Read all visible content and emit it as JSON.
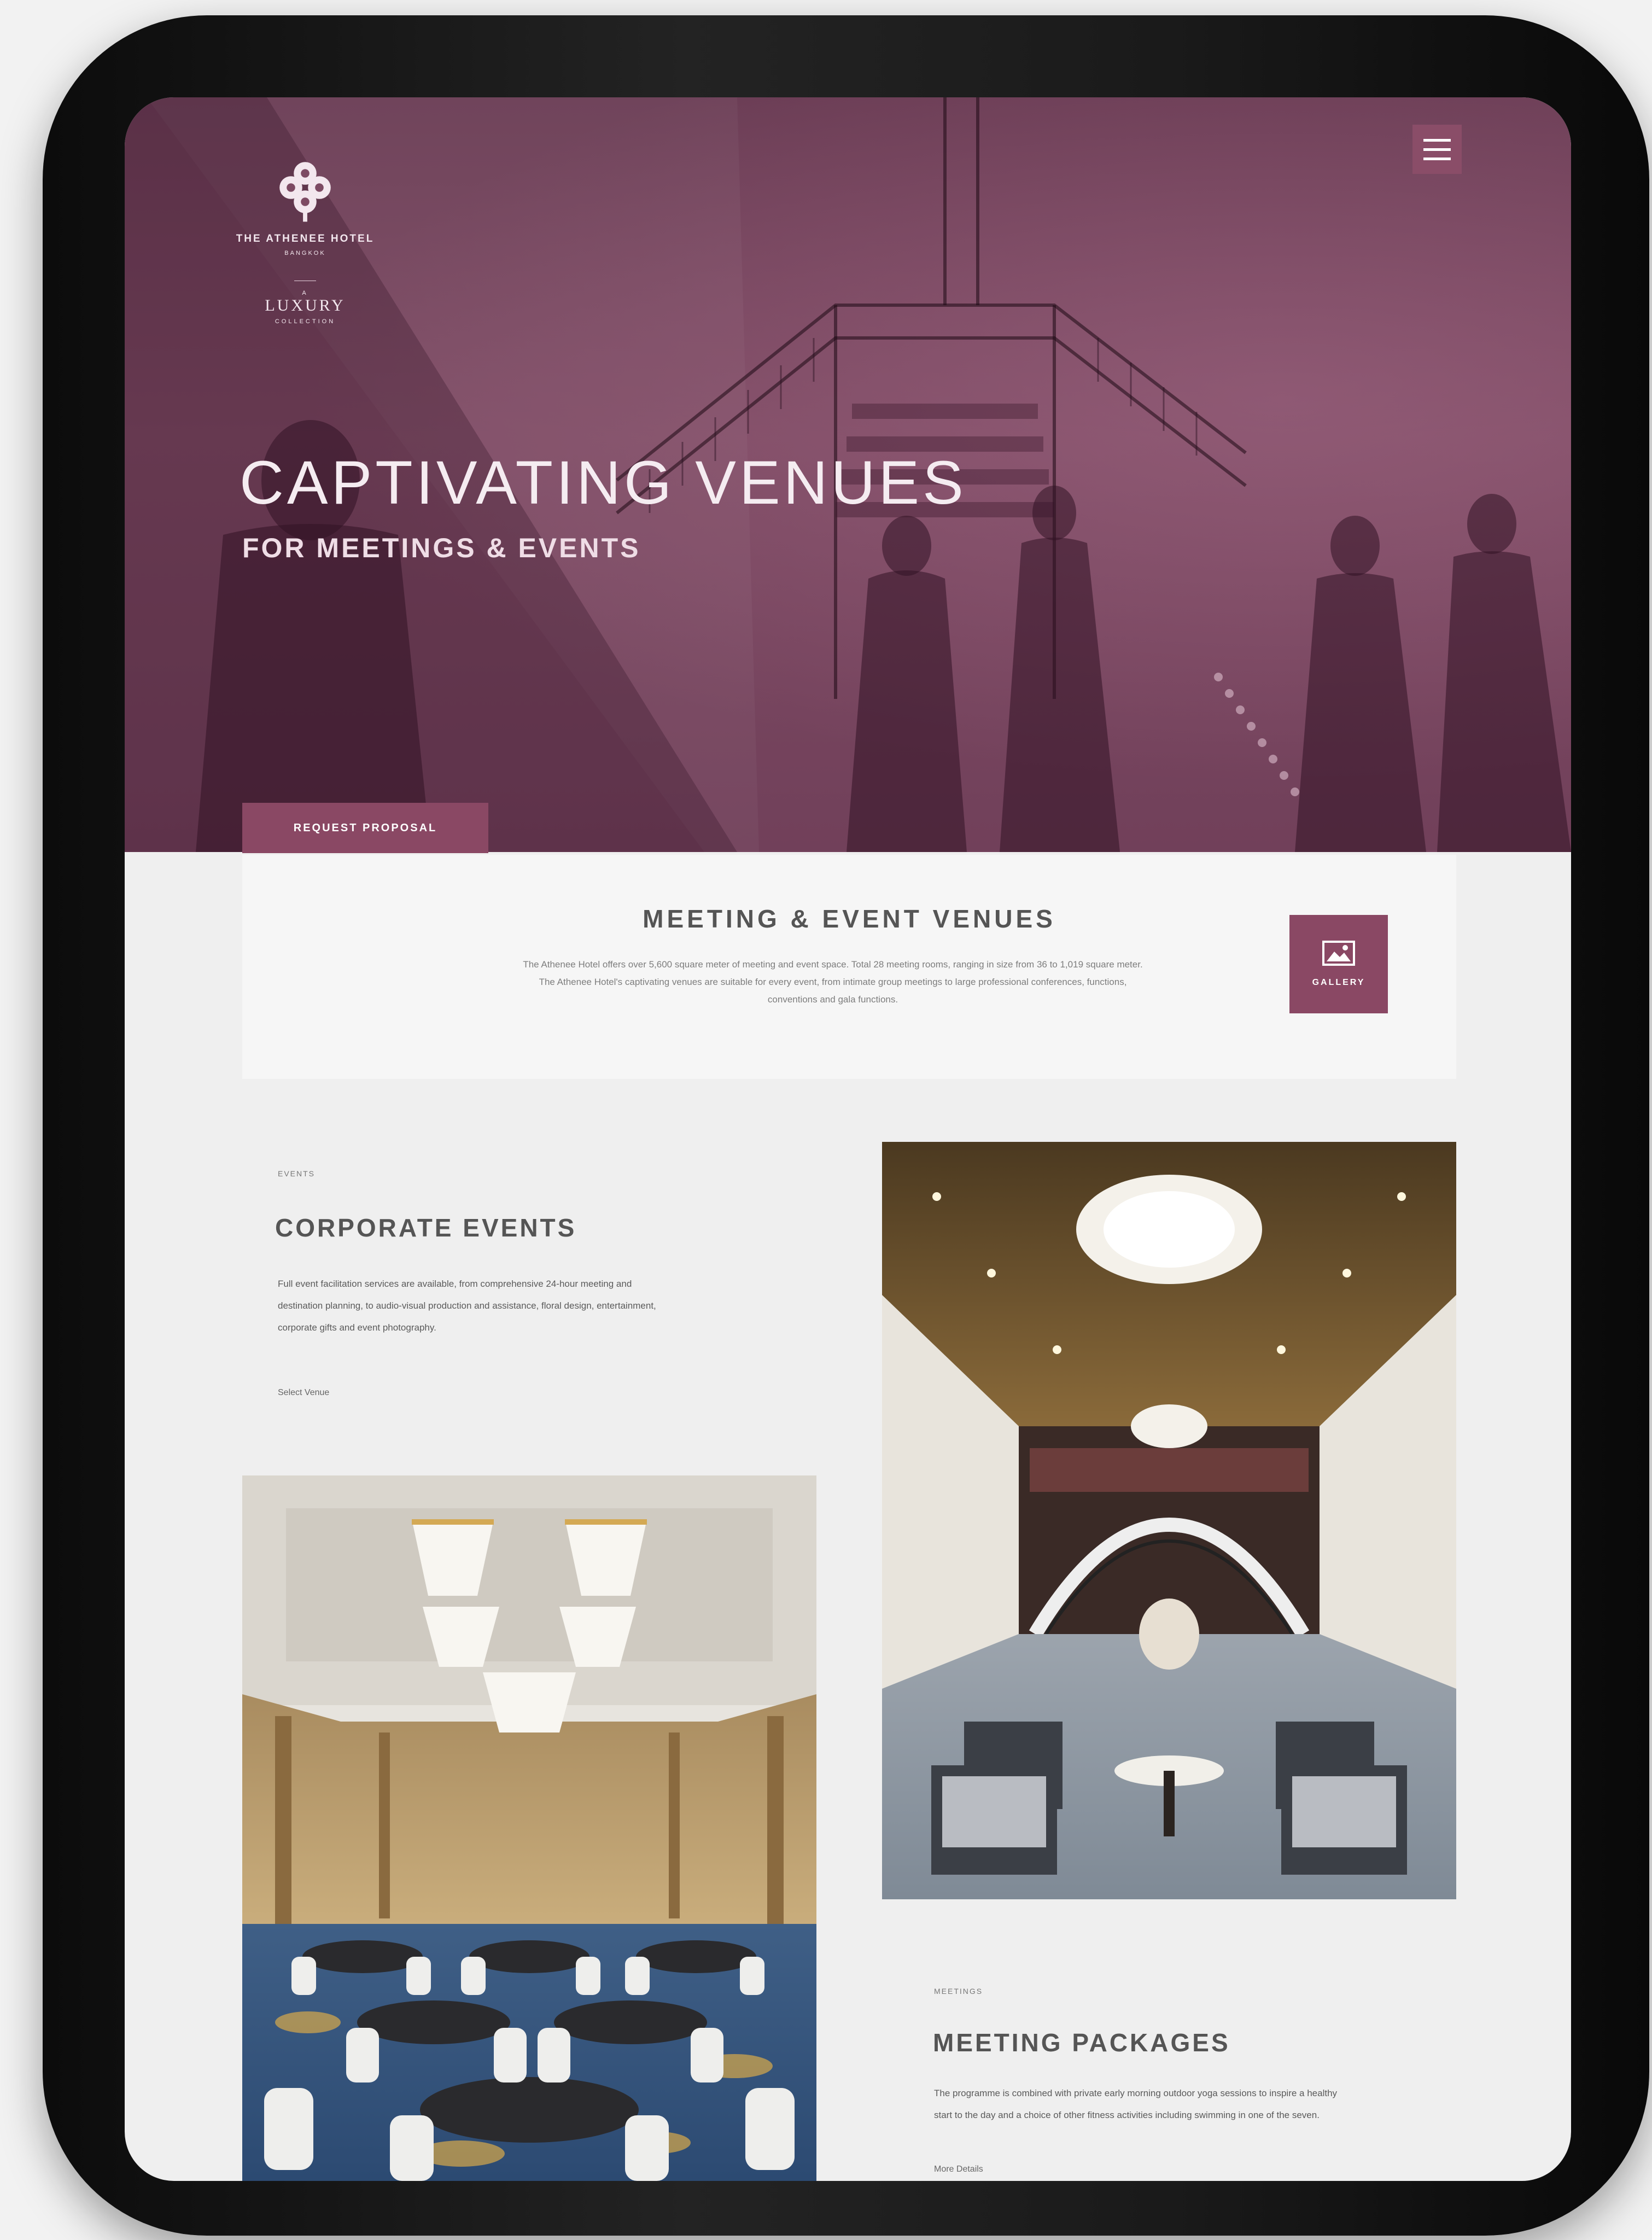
{
  "hero": {
    "logo": {
      "hotel_name": "THE ATHENEE HOTEL",
      "city": "BANGKOK",
      "collection_top": "A",
      "collection_brand": "LUXURY",
      "collection_bottom": "COLLECTION"
    },
    "title": "CAPTIVATING VENUES",
    "subtitle": "FOR MEETINGS & EVENTS",
    "cta_label": "REQUEST PROPOSAL",
    "menu_icon": "hamburger-menu-icon"
  },
  "venues": {
    "title": "MEETING & EVENT VENUES",
    "description": "The Athenee Hotel offers over 5,600 square meter of meeting and event space. Total 28 meeting rooms, ranging in size from 36 to 1,019 square meter. The Athenee Hotel's captivating venues are suitable for every event, from intimate group meetings to large professional conferences, functions, conventions and gala functions.",
    "gallery_label": "GALLERY",
    "gallery_icon": "image-icon"
  },
  "corporate": {
    "eyebrow": "EVENTS",
    "title": "CORPORATE EVENTS",
    "description": "Full event facilitation services are available, from comprehensive 24-hour meeting and destination planning, to audio-visual production and assistance, floral design, entertainment, corporate gifts and event photography.",
    "link": "Select Venue"
  },
  "meetings": {
    "eyebrow": "MEETINGS",
    "title": "MEETING PACKAGES",
    "description": "The programme is combined with private early morning outdoor yoga sessions to inspire a healthy start to the day and a choice of other fitness activities including swimming in one of the seven.",
    "link": "More Details"
  },
  "colors": {
    "brand_plum": "#8a4864",
    "hero_overlay": "#7d4a63",
    "panel_bg": "#f6f6f6",
    "page_bg": "#efefef"
  }
}
